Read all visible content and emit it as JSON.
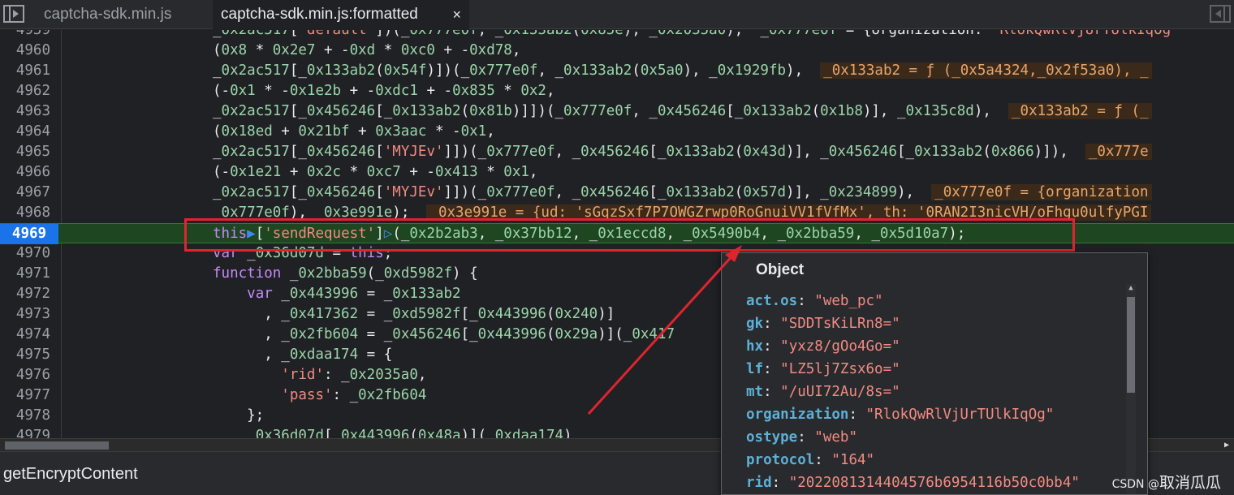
{
  "tabs": [
    {
      "label": "captcha-sdk.min.js",
      "active": false
    },
    {
      "label": "captcha-sdk.min.js:formatted",
      "active": true
    }
  ],
  "tab_close_glyph": "×",
  "lines": [
    {
      "n": "4959",
      "code": "_0x2ac517['default'])(_0x777e0f, _0x133ab2(0x85e), _0x2035a0);  _0x777e0f = {organization: 'RlokQwRlVjUrTUlkIqOg'"
    },
    {
      "n": "4960",
      "code": "(0x8 * 0x2e7 + -0xd * 0xc0 + -0xd78,"
    },
    {
      "n": "4961",
      "code": "_0x2ac517[_0x133ab2(0x54f)])(_0x777e0f, _0x133ab2(0x5a0), _0x1929fb),",
      "inline": "_0x133ab2 = ƒ (_0x5a4324,_0x2f53a0), _"
    },
    {
      "n": "4962",
      "code": "(-0x1 * -0x1e2b + -0xdc1 + -0x835 * 0x2,"
    },
    {
      "n": "4963",
      "code": "_0x2ac517[_0x456246[_0x133ab2(0x81b)]])(_0x777e0f, _0x456246[_0x133ab2(0x1b8)], _0x135c8d),",
      "inline": "_0x133ab2 = ƒ (_"
    },
    {
      "n": "4964",
      "code": "(0x18ed + 0x21bf + 0x3aac * -0x1,"
    },
    {
      "n": "4965",
      "code": "_0x2ac517[_0x456246['MYJEv']])(_0x777e0f, _0x456246[_0x133ab2(0x43d)], _0x456246[_0x133ab2(0x866)]),",
      "inline": "_0x777e"
    },
    {
      "n": "4966",
      "code": "(-0x1e21 + 0x2c * 0xc7 + -0x413 * 0x1,"
    },
    {
      "n": "4967",
      "code": "_0x2ac517[_0x456246['MYJEv']])(_0x777e0f, _0x456246[_0x133ab2(0x57d)], _0x234899),",
      "inline": "_0x777e0f = {organization"
    },
    {
      "n": "4968",
      "code": "_0x777e0f), _0x3e991e);",
      "inline": "_0x3e991e = {ud: 'sGqzSxf7P7OWGZrwp0RoGnuiVV1fVfMx', th: '0RAN2I3nicVH/oFhgu0ulfyPGI"
    },
    {
      "n": "4969",
      "code": "this['sendRequest'](_0x2b2ab3, _0x37bb12, _0x1eccd8, _0x5490b4, _0x2bba59, _0x5d10a7);"
    },
    {
      "n": "4970",
      "code": "var _0x36d07d = this;"
    },
    {
      "n": "4971",
      "code": "function _0x2bba59(_0xd5982f) {"
    },
    {
      "n": "4972",
      "code": "    var _0x443996 = _0x133ab2"
    },
    {
      "n": "4973",
      "code": "      , _0x417362 = _0xd5982f[_0x443996(0x240)]"
    },
    {
      "n": "4974",
      "code": "      , _0x2fb604 = _0x456246[_0x443996(0x29a)](_0x417"
    },
    {
      "n": "4975",
      "code": "      , _0xdaa174 = {"
    },
    {
      "n": "4976",
      "code": "        'rid': _0x2035a0,"
    },
    {
      "n": "4977",
      "code": "        'pass': _0x2fb604"
    },
    {
      "n": "4978",
      "code": "    };"
    },
    {
      "n": "4979",
      "code": "    _0x36d07d[_0x443996(0x48a)](_0xdaa174)"
    }
  ],
  "active_line": "4969",
  "status_text": "getEncryptContent",
  "popover": {
    "title": "Object",
    "props": [
      {
        "k": "act.os",
        "v": "\"web_pc\""
      },
      {
        "k": "gk",
        "v": "\"SDDTsKiLRn8=\""
      },
      {
        "k": "hx",
        "v": "\"yxz8/gOo4Go=\""
      },
      {
        "k": "lf",
        "v": "\"LZ5lj7Zsx6o=\""
      },
      {
        "k": "mt",
        "v": "\"/uUI72Au/8s=\""
      },
      {
        "k": "organization",
        "v": "\"RlokQwRlVjUrTUlkIqOg\""
      },
      {
        "k": "ostype",
        "v": "\"web\""
      },
      {
        "k": "protocol",
        "v": "\"164\""
      },
      {
        "k": "rid",
        "v": "\"2022081314404576b6954116b50c0bb4\""
      }
    ]
  },
  "watermark": {
    "small": "CSDN @",
    "big": "取消瓜瓜"
  },
  "colors": {
    "accent": "#1a73e8",
    "highlight_box": "#e0242f",
    "active_line": "#1e4620"
  }
}
